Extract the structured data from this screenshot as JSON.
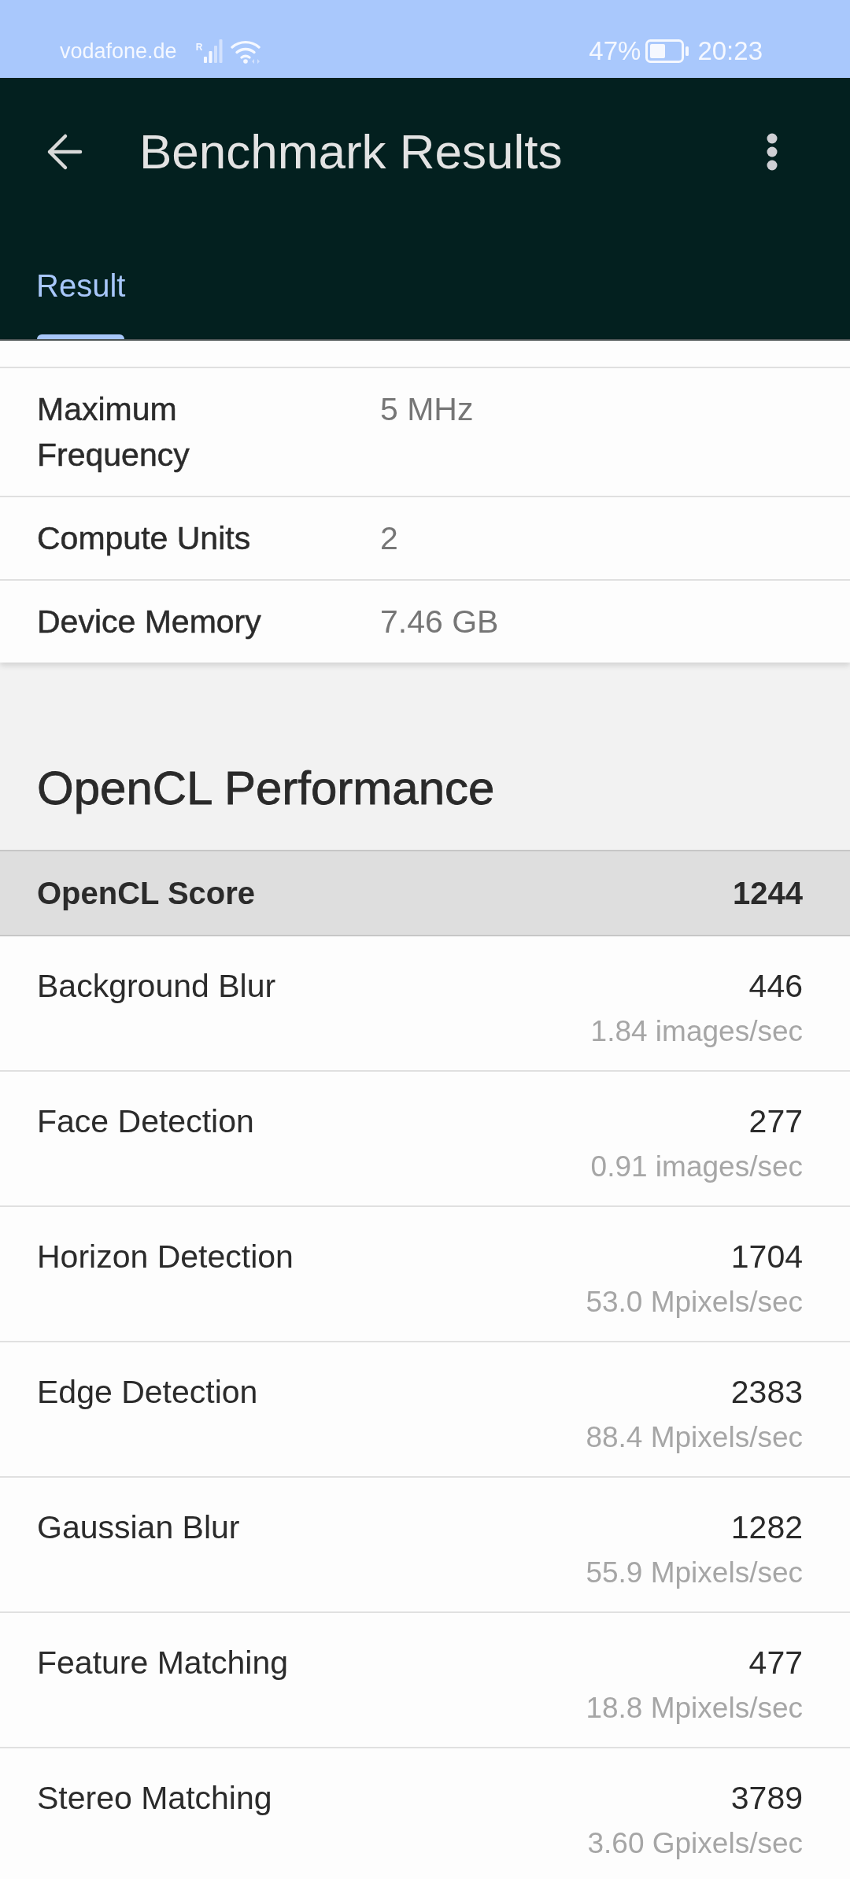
{
  "status_bar": {
    "carrier": "vodafone.de",
    "network_tag": "R",
    "battery": "47%",
    "time": "20:23"
  },
  "app_bar": {
    "title": "Benchmark Results"
  },
  "tabs": [
    {
      "label": "Result",
      "selected": true
    }
  ],
  "device_info": [
    {
      "label": "Maximum Frequency",
      "value": "5 MHz"
    },
    {
      "label": "Compute Units",
      "value": "2"
    },
    {
      "label": "Device Memory",
      "value": "7.46 GB"
    }
  ],
  "opencl": {
    "heading": "OpenCL Performance",
    "summary": {
      "label": "OpenCL Score",
      "score": "1244"
    },
    "tests": [
      {
        "name": "Background Blur",
        "score": "446",
        "rate": "1.84 images/sec"
      },
      {
        "name": "Face Detection",
        "score": "277",
        "rate": "0.91 images/sec"
      },
      {
        "name": "Horizon Detection",
        "score": "1704",
        "rate": "53.0 Mpixels/sec"
      },
      {
        "name": "Edge Detection",
        "score": "2383",
        "rate": "88.4 Mpixels/sec"
      },
      {
        "name": "Gaussian Blur",
        "score": "1282",
        "rate": "55.9 Mpixels/sec"
      },
      {
        "name": "Feature Matching",
        "score": "477",
        "rate": "18.8 Mpixels/sec"
      },
      {
        "name": "Stereo Matching",
        "score": "3789",
        "rate": "3.60 Gpixels/sec"
      }
    ]
  }
}
